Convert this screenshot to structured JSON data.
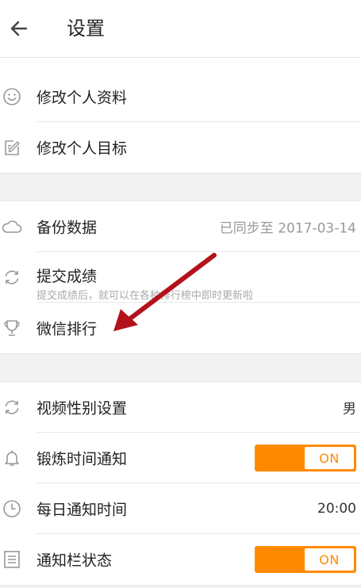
{
  "header": {
    "title": "设置",
    "back_icon": "arrow-left-icon"
  },
  "colors": {
    "accent": "#ff8a00",
    "annotation_arrow": "#b3121c",
    "background_band": "#f2f2f2"
  },
  "section1": {
    "items": [
      {
        "icon": "smiley-face-icon",
        "label": "修改个人资料"
      },
      {
        "icon": "edit-note-icon",
        "label": "修改个人目标"
      }
    ]
  },
  "section2": {
    "items": [
      {
        "icon": "cloud-icon",
        "label": "备份数据",
        "value": "已同步至  2017-03-14"
      },
      {
        "icon": "sync-icon",
        "label": "提交成绩",
        "sub": "提交成绩后，就可以在各种排行榜中即时更新啦"
      },
      {
        "icon": "trophy-icon",
        "label": "微信排行"
      }
    ]
  },
  "section3": {
    "items": [
      {
        "icon": "sync-icon",
        "label": "视频性别设置",
        "value": "男"
      },
      {
        "icon": "bell-icon",
        "label": "锻炼时间通知",
        "toggle": "ON"
      },
      {
        "icon": "clock-icon",
        "label": "每日通知时间",
        "value": "20:00"
      },
      {
        "icon": "list-icon",
        "label": "通知栏状态",
        "toggle": "ON"
      }
    ]
  },
  "annotation": {
    "icon": "red-arrow-icon"
  }
}
